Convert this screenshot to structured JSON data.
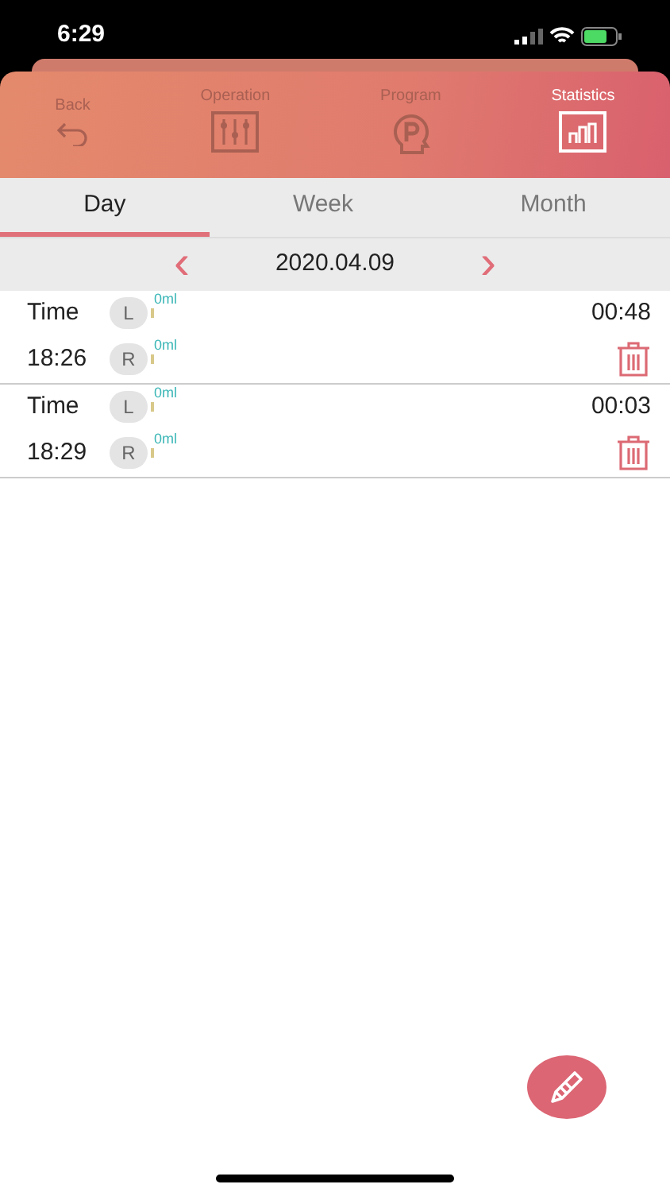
{
  "status_bar": {
    "time": "6:29"
  },
  "nav": [
    {
      "label": "Back",
      "kind": "back",
      "selected": false
    },
    {
      "label": "Operation",
      "kind": "operation",
      "selected": false
    },
    {
      "label": "Program",
      "kind": "program",
      "selected": false
    },
    {
      "label": "Statistics",
      "kind": "statistics",
      "selected": true
    }
  ],
  "tabs": [
    {
      "label": "Day",
      "selected": true
    },
    {
      "label": "Week",
      "selected": false
    },
    {
      "label": "Month",
      "selected": false
    }
  ],
  "date": {
    "prev": "‹",
    "value": "2020.04.09",
    "next": "›"
  },
  "records": [
    {
      "time_label": "Time",
      "time": "18:26",
      "duration": "00:48",
      "sides": [
        {
          "side": "L",
          "amount": "0ml"
        },
        {
          "side": "R",
          "amount": "0ml"
        }
      ]
    },
    {
      "time_label": "Time",
      "time": "18:29",
      "duration": "00:03",
      "sides": [
        {
          "side": "L",
          "amount": "0ml"
        },
        {
          "side": "R",
          "amount": "0ml"
        }
      ]
    }
  ]
}
